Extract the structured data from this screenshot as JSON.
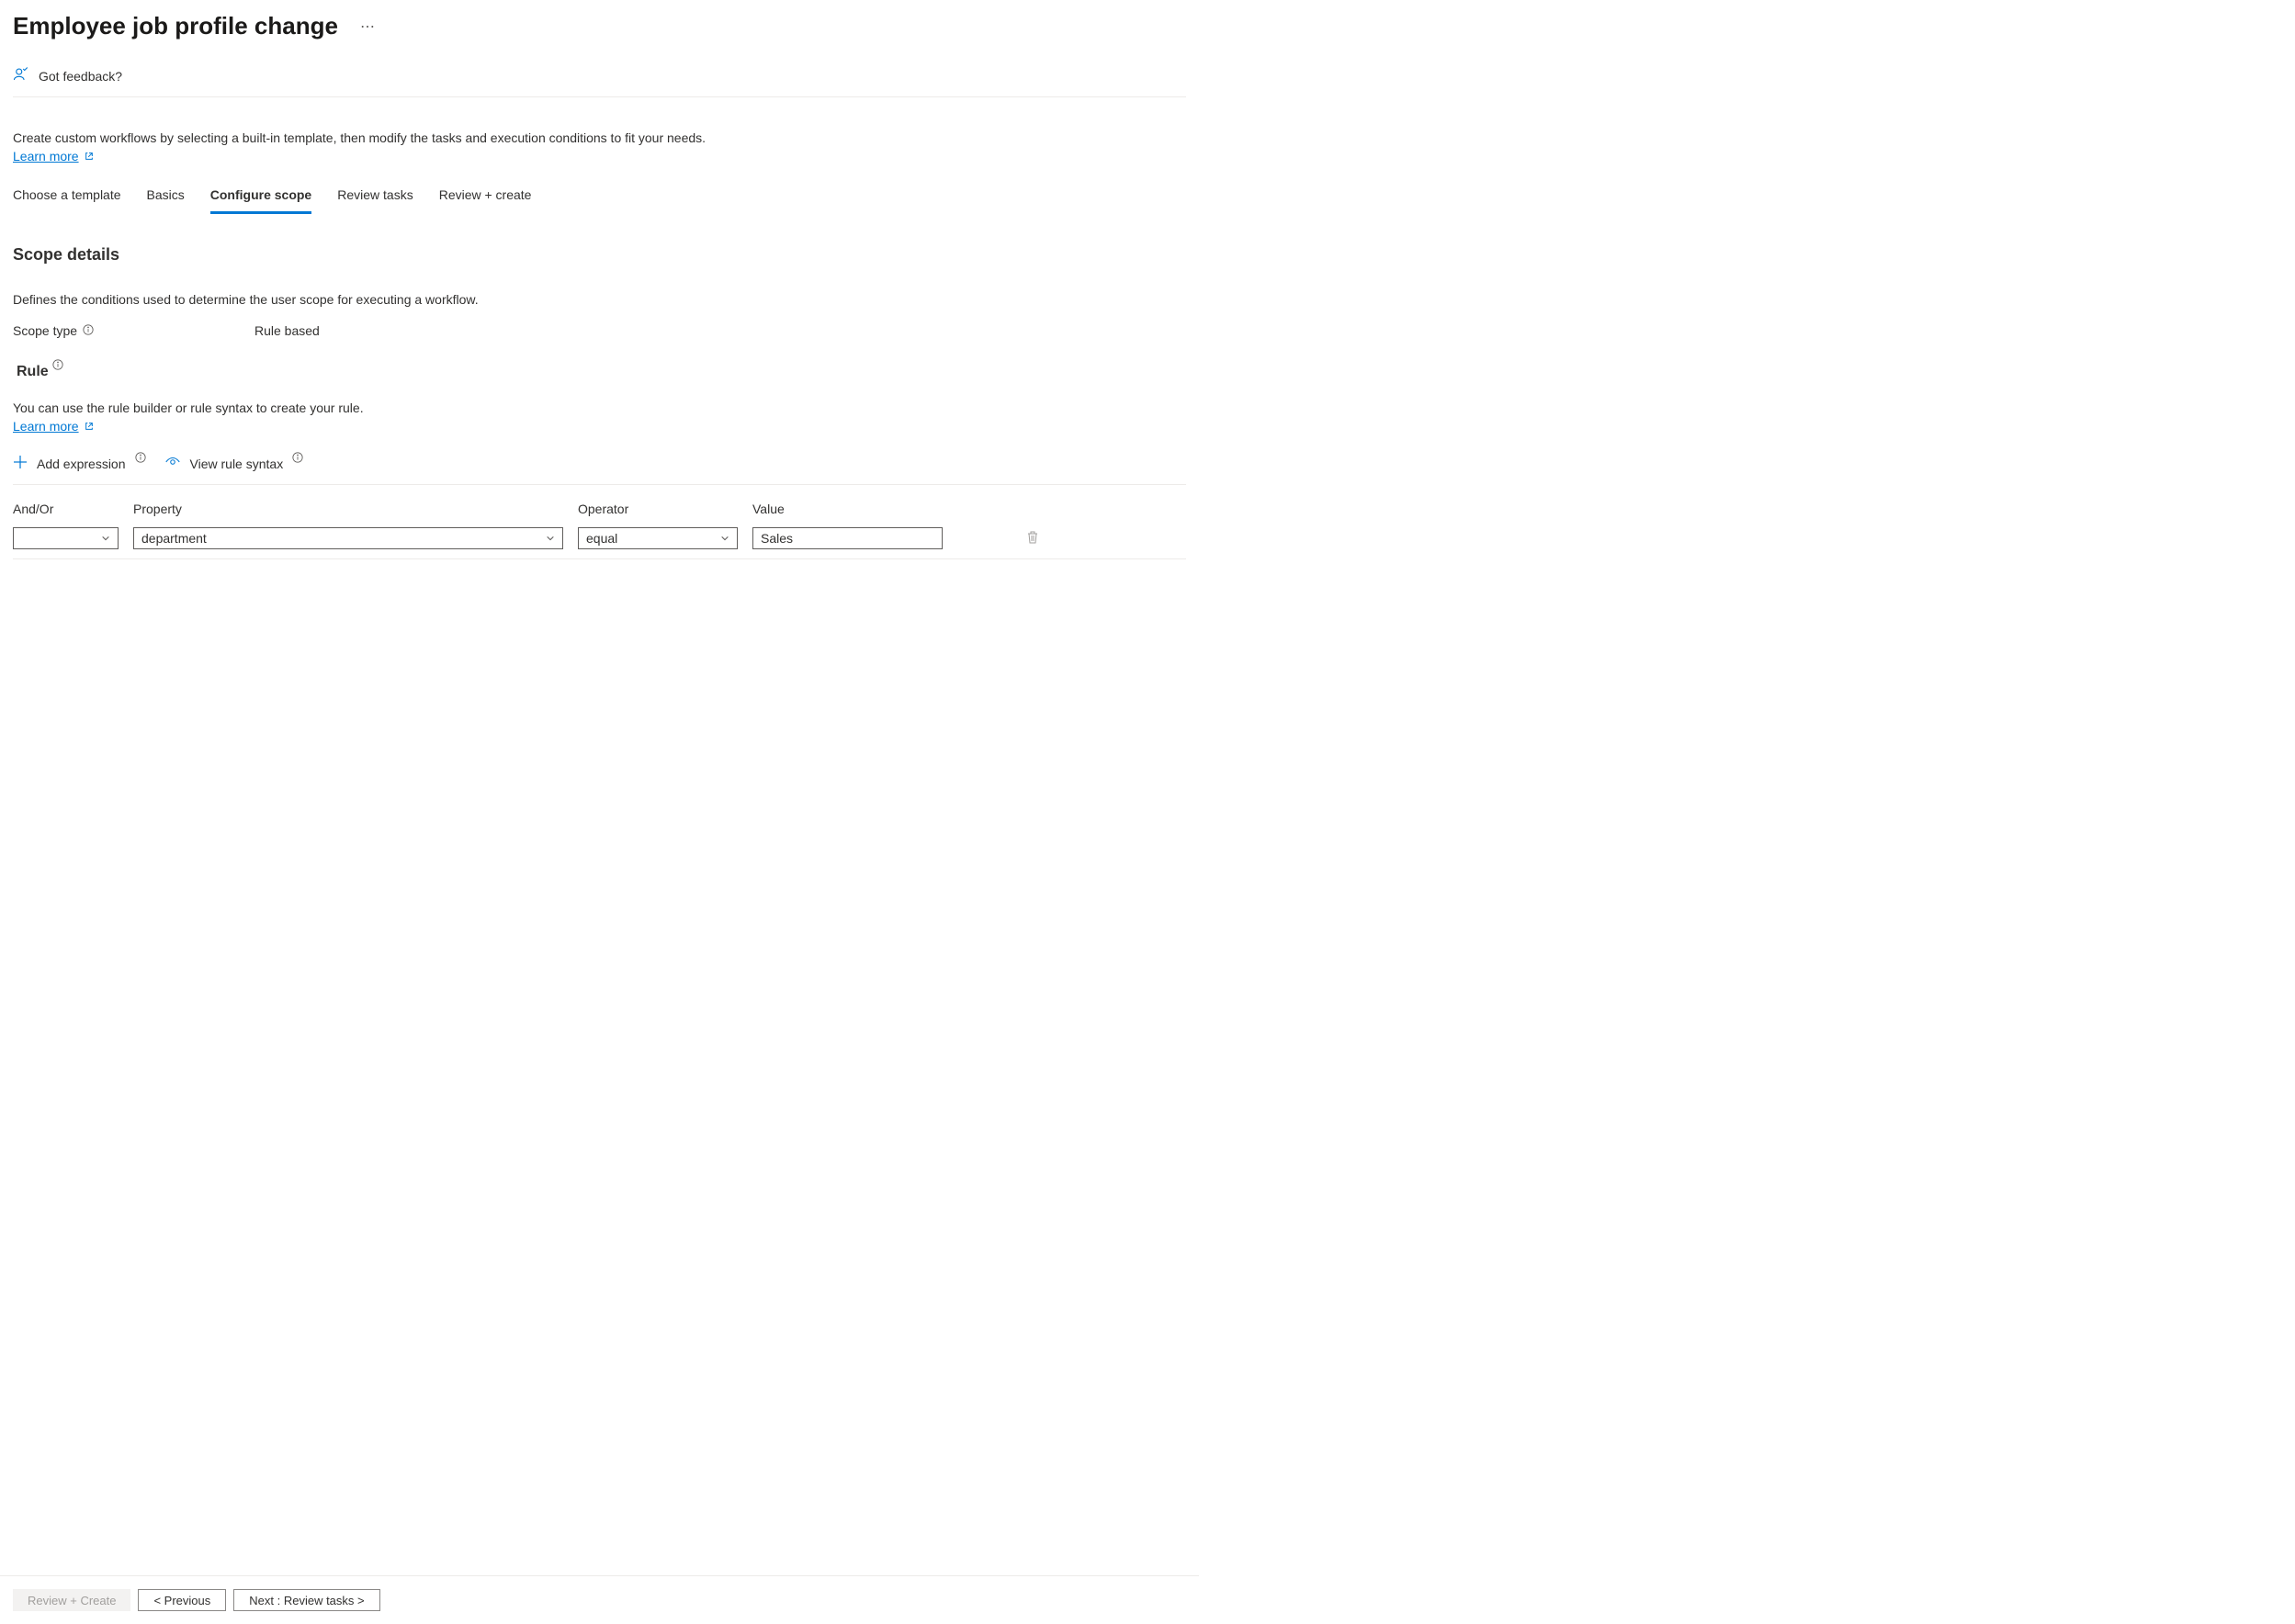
{
  "page": {
    "title": "Employee job profile change",
    "feedback_label": "Got feedback?",
    "intro_text": "Create custom workflows by selecting a built-in template, then modify the tasks and execution conditions to fit your needs.",
    "learn_more": "Learn more"
  },
  "tabs": [
    {
      "label": "Choose a template",
      "active": false
    },
    {
      "label": "Basics",
      "active": false
    },
    {
      "label": "Configure scope",
      "active": true
    },
    {
      "label": "Review tasks",
      "active": false
    },
    {
      "label": "Review + create",
      "active": false
    }
  ],
  "scope": {
    "section_title": "Scope details",
    "section_desc": "Defines the conditions used to determine the user scope for executing a workflow.",
    "scope_type_label": "Scope type",
    "scope_type_value": "Rule based",
    "rule_title": "Rule",
    "rule_desc": "You can use the rule builder or rule syntax to create your rule.",
    "learn_more": "Learn more",
    "add_expression": "Add expression",
    "view_syntax": "View rule syntax"
  },
  "rule_table": {
    "headers": {
      "andor": "And/Or",
      "property": "Property",
      "operator": "Operator",
      "value": "Value"
    },
    "rows": [
      {
        "andor": "",
        "property": "department",
        "operator": "equal",
        "value": "Sales"
      }
    ]
  },
  "footer": {
    "review_create": "Review + Create",
    "previous": "< Previous",
    "next": "Next : Review tasks >"
  }
}
